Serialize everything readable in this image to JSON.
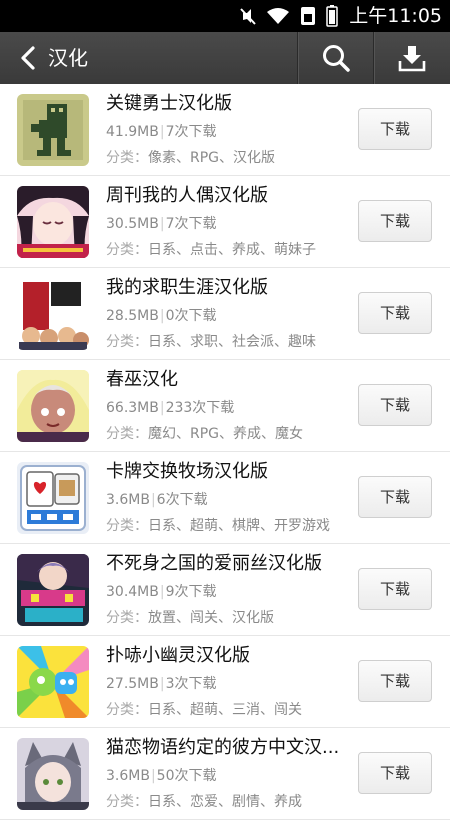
{
  "status_bar": {
    "time": "上午11:05"
  },
  "header": {
    "title": "汉化"
  },
  "list_labels": {
    "category_prefix": "分类："
  },
  "apps": [
    {
      "name": "关键勇士汉化版",
      "size": "41.9MB",
      "downloads": "7次下载",
      "tags": "像素、RPG、汉化版",
      "button": "下载"
    },
    {
      "name": "周刊我的人偶汉化版",
      "size": "30.5MB",
      "downloads": "7次下载",
      "tags": "日系、点击、养成、萌妹子",
      "button": "下载"
    },
    {
      "name": "我的求职生涯汉化版",
      "size": "28.5MB",
      "downloads": "0次下载",
      "tags": "日系、求职、社会派、趣味",
      "button": "下载"
    },
    {
      "name": "春巫汉化",
      "size": "66.3MB",
      "downloads": "233次下载",
      "tags": "魔幻、RPG、养成、魔女",
      "button": "下载"
    },
    {
      "name": "卡牌交换牧场汉化版",
      "size": "3.6MB",
      "downloads": "6次下载",
      "tags": "日系、超萌、棋牌、开罗游戏",
      "button": "下载"
    },
    {
      "name": "不死身之国的爱丽丝汉化版",
      "size": "30.4MB",
      "downloads": "9次下载",
      "tags": "放置、闯关、汉化版",
      "button": "下载"
    },
    {
      "name": "扑哧小幽灵汉化版",
      "size": "27.5MB",
      "downloads": "3次下载",
      "tags": "日系、超萌、三消、闯关",
      "button": "下载"
    },
    {
      "name": "猫恋物语约定的彼方中文汉...",
      "size": "3.6MB",
      "downloads": "50次下载",
      "tags": "日系、恋爱、剧情、养成",
      "button": "下载"
    }
  ]
}
